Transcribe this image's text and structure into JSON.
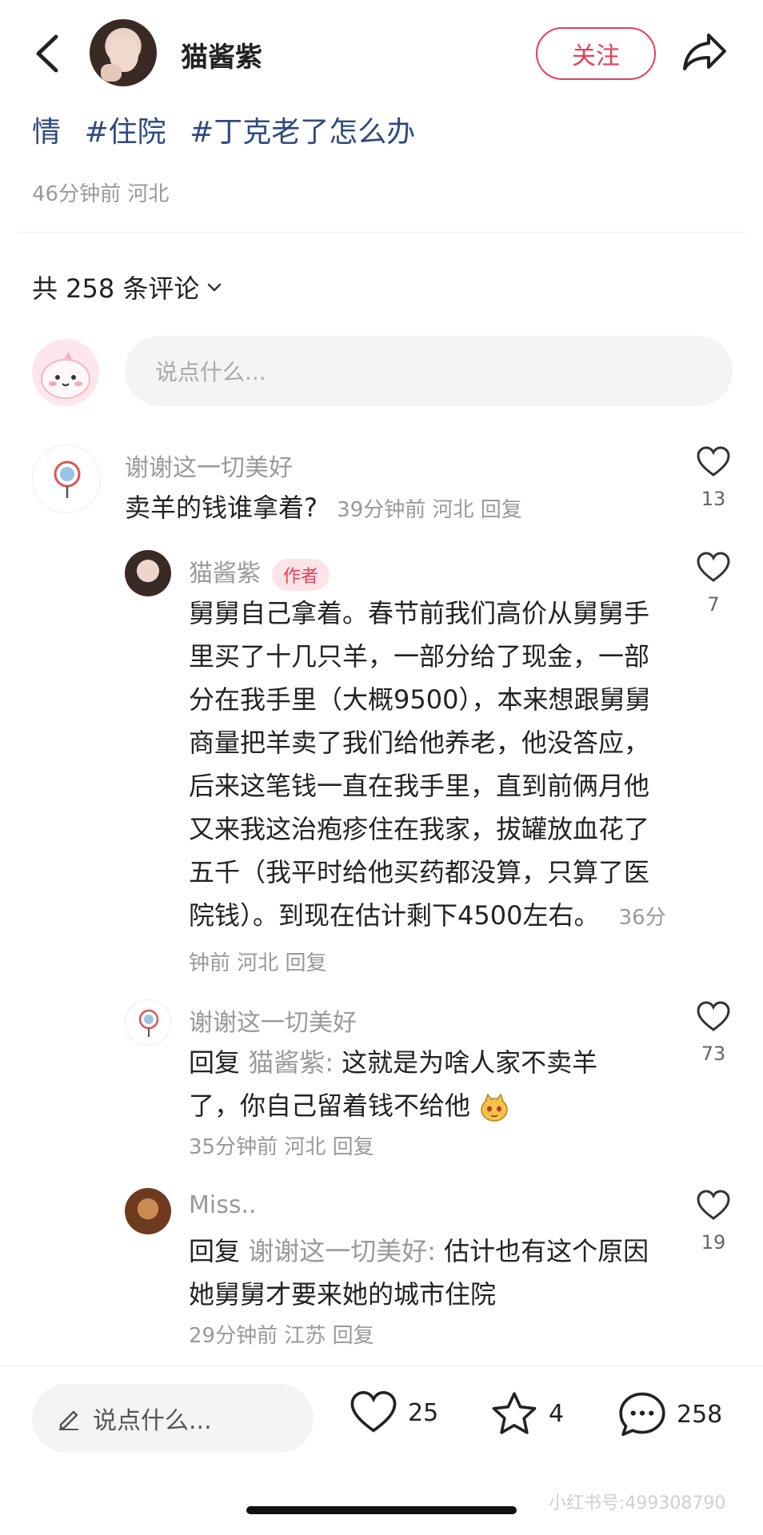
{
  "header": {
    "author_name": "猫酱紫",
    "follow_label": "关注"
  },
  "post": {
    "tags": [
      "情",
      "#住院",
      "#丁克老了怎么办"
    ],
    "meta": "46分钟前 河北"
  },
  "comments_header": {
    "count_label": "共 258 条评论"
  },
  "comment_input": {
    "placeholder": "说点什么..."
  },
  "comments": [
    {
      "name": "谢谢这一切美好",
      "text": "卖羊的钱谁拿着?",
      "meta": "39分钟前 河北 回复",
      "likes": "13"
    },
    {
      "name": "猫酱紫",
      "badge": "作者",
      "text": "舅舅自己拿着。春节前我们高价从舅舅手里买了十几只羊，一部分给了现金，一部分在我手里（大概9500），本来想跟舅舅商量把羊卖了我们给他养老，他没答应，后来这笔钱一直在我手里，直到前俩月他又来我这治疱疹住在我家，拔罐放血花了五千（我平时给他买药都没算，只算了医院钱）。到现在估计剩下4500左右。",
      "meta": "36分钟前 河北 回复",
      "likes": "7"
    },
    {
      "name": "谢谢这一切美好",
      "reply_prefix": "回复",
      "reply_to": "猫酱紫:",
      "text": "这就是为啥人家不卖羊了，你自己留着钱不给他",
      "meta": "35分钟前 河北 回复",
      "likes": "73"
    },
    {
      "name": "Miss..",
      "reply_prefix": "回复",
      "reply_to": "谢谢这一切美好:",
      "text": "估计也有这个原因 她舅舅才要来她的城市住院",
      "meta": "29分钟前 江苏 回复",
      "likes": "19"
    }
  ],
  "bottom_bar": {
    "input_placeholder": "说点什么...",
    "likes": "25",
    "stars": "4",
    "comments": "258"
  },
  "watermark": "小红书号:499308790",
  "colors": {
    "accent": "#e3405a",
    "tag": "#2e4a7f",
    "muted": "#999999"
  }
}
